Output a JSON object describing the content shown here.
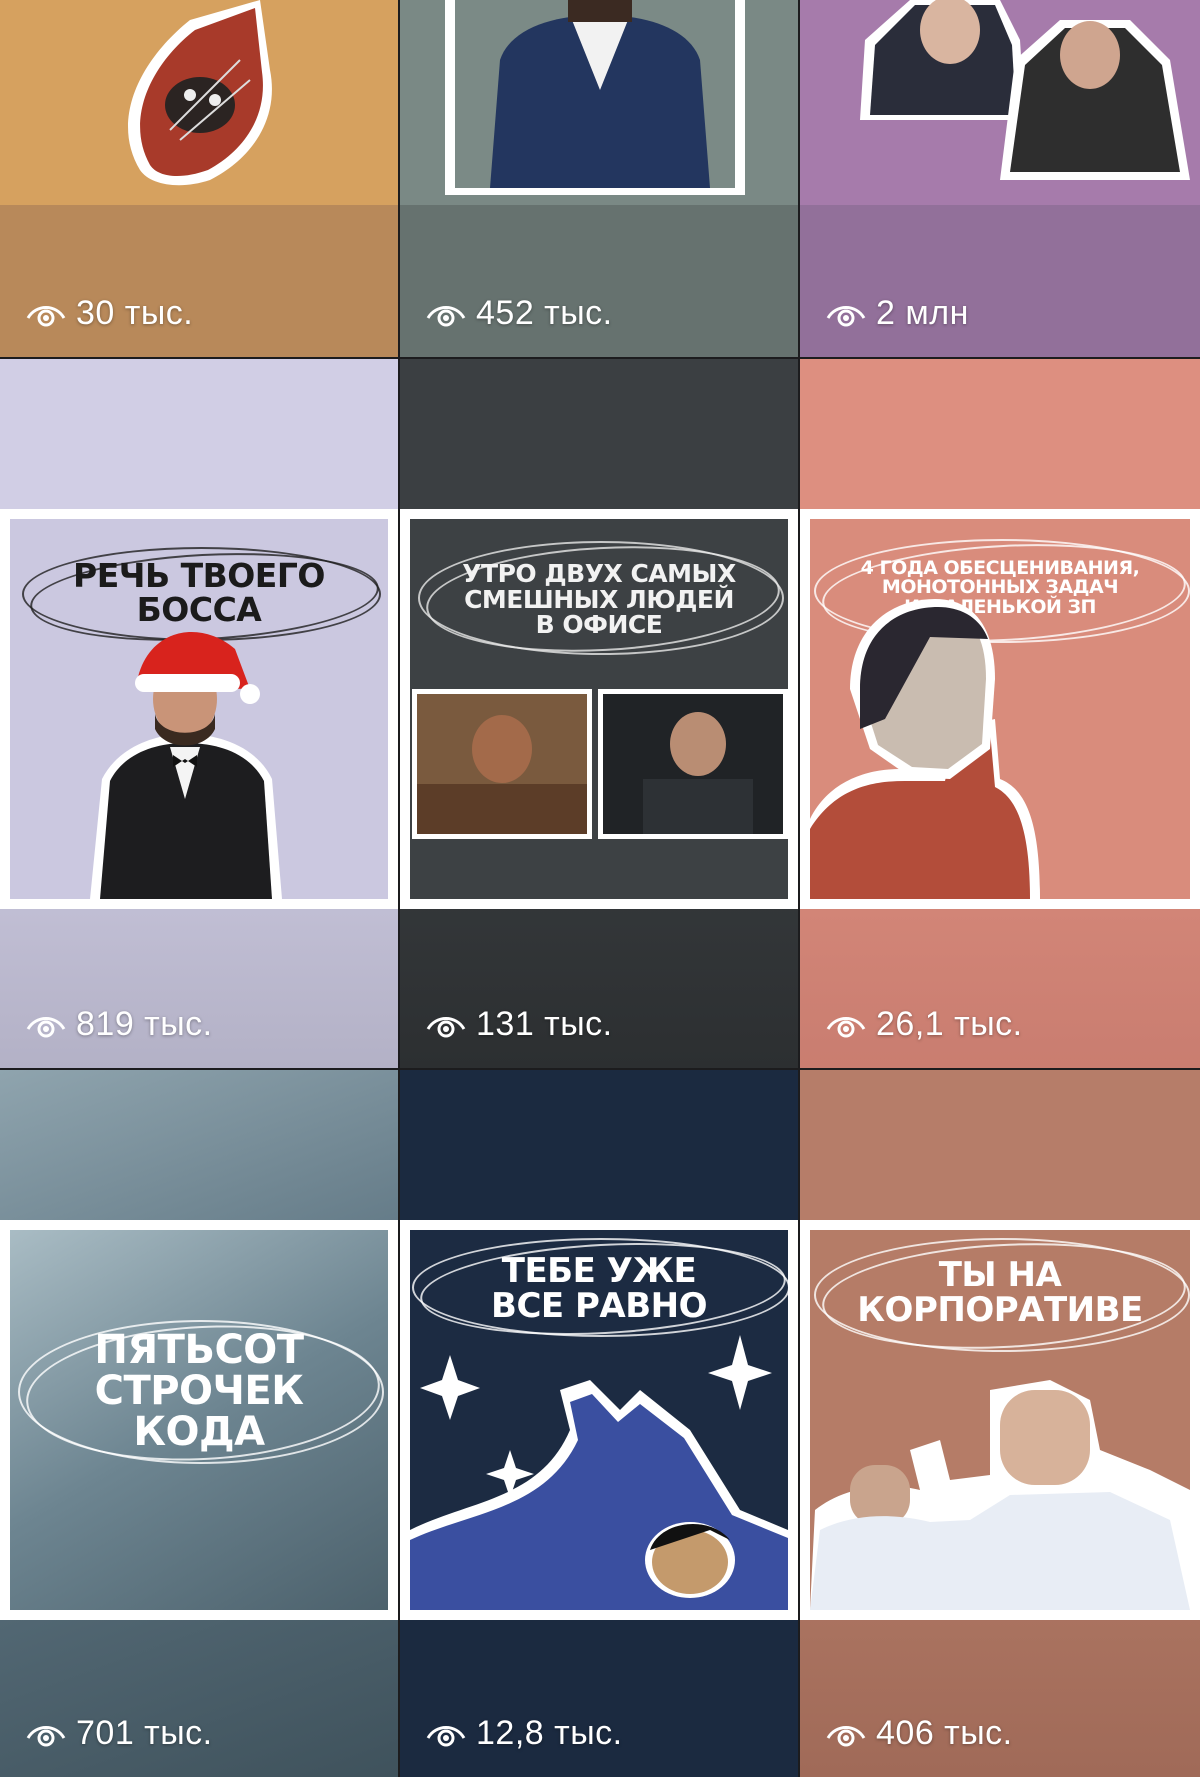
{
  "tiles": [
    {
      "views": "30 тыс.",
      "bg": "#c99a5e",
      "caption": ""
    },
    {
      "views": "452 тыс.",
      "bg": "#6e7d79",
      "caption": ""
    },
    {
      "views": "2 млн",
      "bg": "#a27aa8",
      "caption": ""
    },
    {
      "views": "819 тыс.",
      "bg": "#c7c4dc",
      "caption_lines": [
        "РЕЧЬ ТВОЕГО",
        "БОССА"
      ]
    },
    {
      "views": "131 тыс.",
      "bg": "#3a3d40",
      "caption_lines": [
        "УТРО ДВУХ САМЫХ",
        "СМЕШНЫХ ЛЮДЕЙ",
        "В ОФИСЕ"
      ]
    },
    {
      "views": "26,1 тыс.",
      "bg": "#d88a7b",
      "caption_lines": [
        "4 ГОДА ОБЕСЦЕНИВАНИЯ,",
        "МОНОТОННЫХ ЗАДАЧ",
        "И МАЛЕНЬКОЙ ЗП"
      ]
    },
    {
      "views": "701 тыс.",
      "bg": "#5f7683",
      "caption_lines": [
        "ПЯТЬСОТ",
        "СТРОЧЕК",
        "КОДА"
      ]
    },
    {
      "views": "12,8 тыс.",
      "bg": "#1b2a40",
      "caption_lines": [
        "ТЕБЕ УЖЕ",
        "ВСЕ РАВНО"
      ]
    },
    {
      "views": "406 тыс.",
      "bg": "#b47a66",
      "caption_lines": [
        "ТЫ НА",
        "КОРПОРАТИВЕ"
      ]
    }
  ]
}
